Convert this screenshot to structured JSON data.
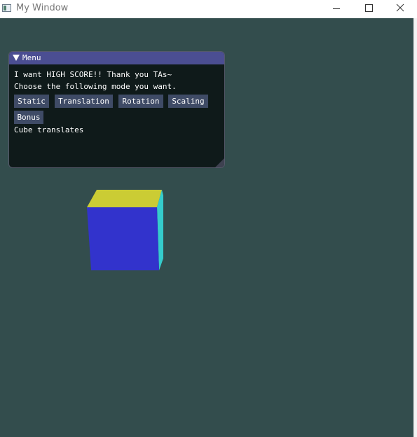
{
  "window": {
    "title": "My Window",
    "controls": {
      "minimize_icon": "minimize-icon",
      "maximize_icon": "maximize-icon",
      "close_icon": "close-icon"
    }
  },
  "viewport": {
    "background": "#334d4d"
  },
  "menu": {
    "title": "Menu",
    "collapse_icon": "triangle-down-icon",
    "line1": "I want HIGH SCORE!! Thank you TAs~",
    "line2": "Choose the following mode you want.",
    "buttons": [
      {
        "label": "Static"
      },
      {
        "label": "Translation"
      },
      {
        "label": "Rotation"
      },
      {
        "label": "Scaling"
      },
      {
        "label": "Bonus"
      }
    ],
    "status": "Cube translates",
    "colors": {
      "header": "#4b4e92",
      "body": "#0f1a1a",
      "button": "#3f4b66"
    }
  },
  "cube": {
    "face_colors": {
      "top": "#cbcc34",
      "front": "#3233cc",
      "side": "#35cccc"
    }
  }
}
